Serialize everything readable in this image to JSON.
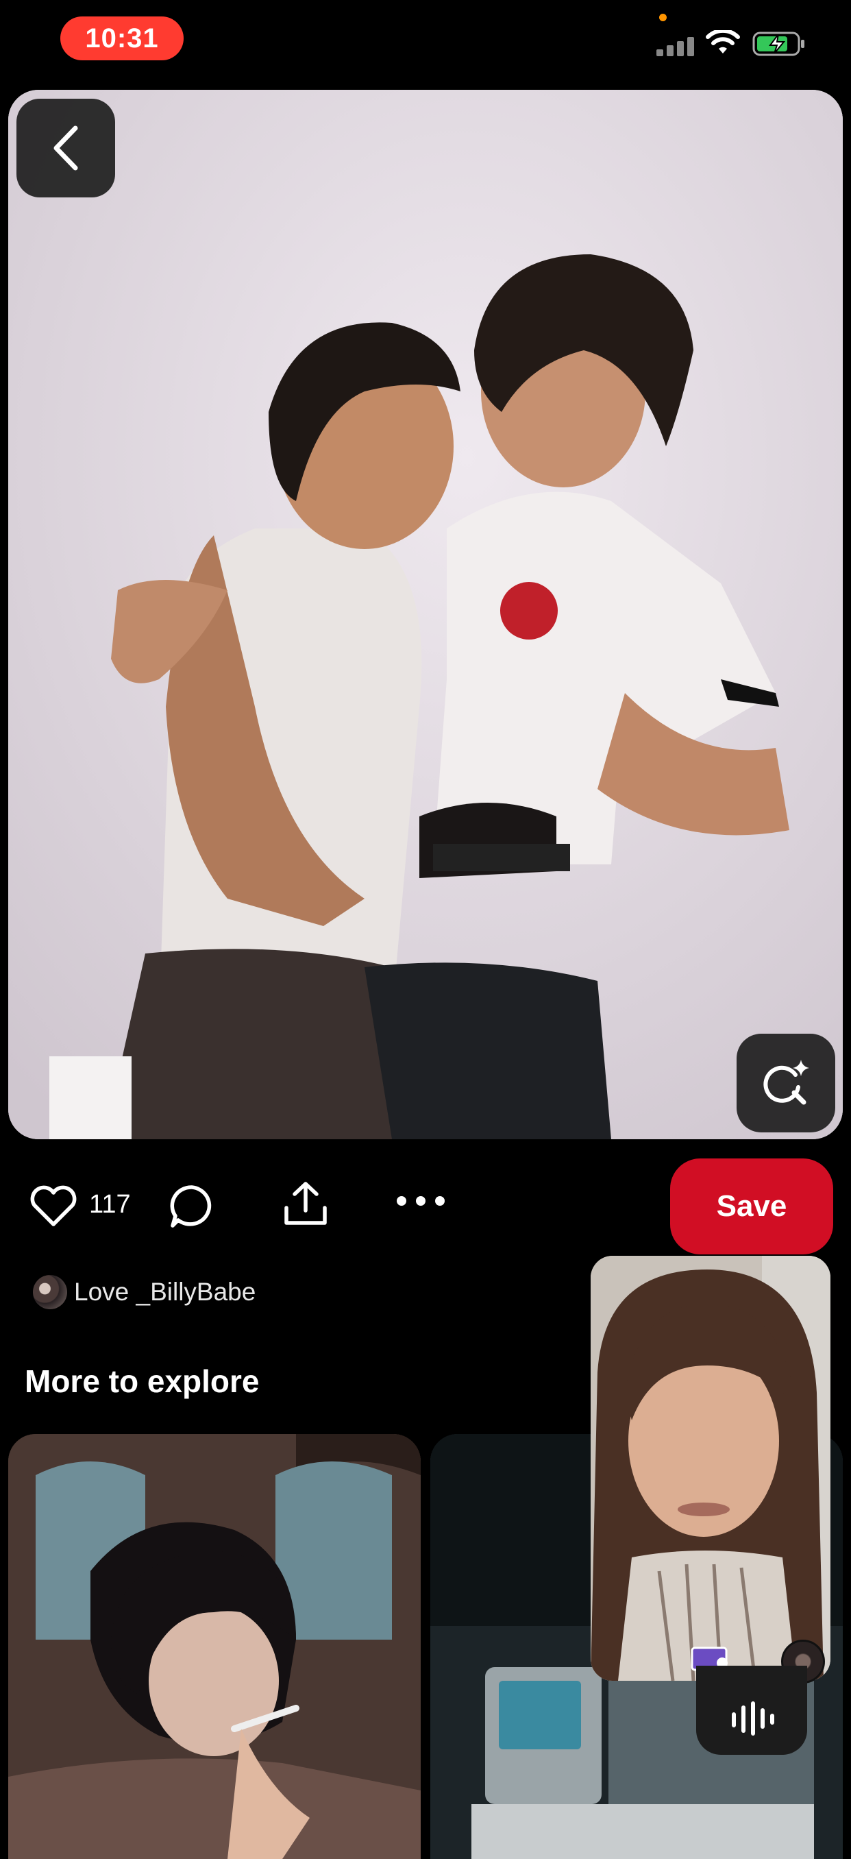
{
  "status_bar": {
    "time": "10:31",
    "icons": [
      "recording-dot-icon",
      "cellular-signal-icon",
      "wifi-icon",
      "battery-charging-icon"
    ]
  },
  "pin": {
    "image_alt": "",
    "back_icon": "chevron-left-icon",
    "visual_search_icon": "visual-search-sparkle-icon",
    "like_count": "117",
    "save_label": "Save",
    "actions": [
      "heart-icon",
      "comment-icon",
      "share-icon",
      "more-icon"
    ]
  },
  "author": {
    "name": "Love _BillyBabe"
  },
  "explore": {
    "title": "More to explore"
  },
  "pip": {
    "icons": [
      "screen-share-icon",
      "caller-avatar"
    ]
  },
  "colors": {
    "accent": "#d10e24",
    "time_pill": "#ff3b30",
    "background": "#000000"
  }
}
